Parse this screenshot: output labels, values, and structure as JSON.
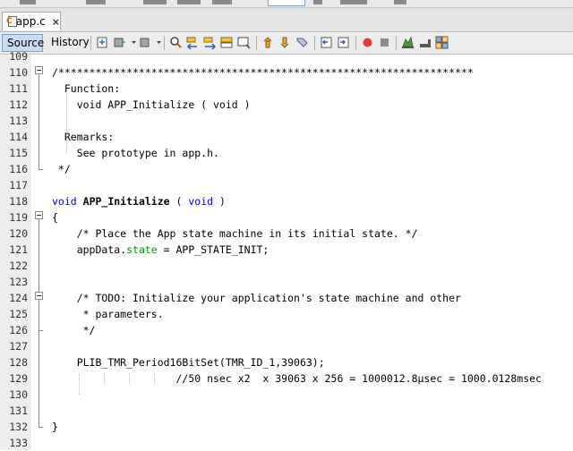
{
  "tab": {
    "filename": "app.c",
    "close_glyph": "×"
  },
  "view_tabs": {
    "source": "Source",
    "history": "History"
  },
  "toolbar_icons": [
    "last-edit-icon",
    "back-icon",
    "forward-icon",
    "find-icon",
    "find-previous-icon",
    "find-next-icon",
    "find-selection-icon",
    "toggle-highlight-icon",
    "previous-bookmark-icon",
    "next-bookmark-icon",
    "toggle-bookmark-icon",
    "shift-left-icon",
    "shift-right-icon",
    "start-macro-icon",
    "stop-macro-icon",
    "comment-icon",
    "uncomment-icon",
    "diff-icon"
  ],
  "editor": {
    "lines": [
      {
        "num": "109",
        "text": ""
      },
      {
        "num": "110",
        "text": "/*******************************************************************"
      },
      {
        "num": "111",
        "text": "  Function:"
      },
      {
        "num": "112",
        "text": "    void APP_Initialize ( void )"
      },
      {
        "num": "113",
        "text": ""
      },
      {
        "num": "114",
        "text": "  Remarks:"
      },
      {
        "num": "115",
        "text": "    See prototype in app.h."
      },
      {
        "num": "116",
        "text": " */"
      },
      {
        "num": "117",
        "text": ""
      },
      {
        "num": "118",
        "kw1": "void",
        "fn": "APP_Initialize",
        "kw2": "void",
        "pre2": " ( ",
        "post": " )"
      },
      {
        "num": "119",
        "text": "{"
      },
      {
        "num": "120",
        "text": "    /* Place the App state machine in its initial state. */"
      },
      {
        "num": "121",
        "pre": "    appData.",
        "field": "state",
        "post": " = APP_STATE_INIT;"
      },
      {
        "num": "122",
        "text": ""
      },
      {
        "num": "123",
        "text": ""
      },
      {
        "num": "124",
        "text": "    /* TODO: Initialize your application's state machine and other"
      },
      {
        "num": "125",
        "text": "     * parameters."
      },
      {
        "num": "126",
        "text": "     */"
      },
      {
        "num": "127",
        "text": ""
      },
      {
        "num": "128",
        "text": "    PLIB_TMR_Period16BitSet(TMR_ID_1,39063);"
      },
      {
        "num": "129",
        "text": "                    //50 nsec x2  x 39063 x 256 = 1000012.8μsec = 1000.0128msec"
      },
      {
        "num": "130",
        "text": ""
      },
      {
        "num": "131",
        "text": ""
      },
      {
        "num": "132",
        "text": "}"
      },
      {
        "num": "133",
        "text": ""
      }
    ]
  }
}
